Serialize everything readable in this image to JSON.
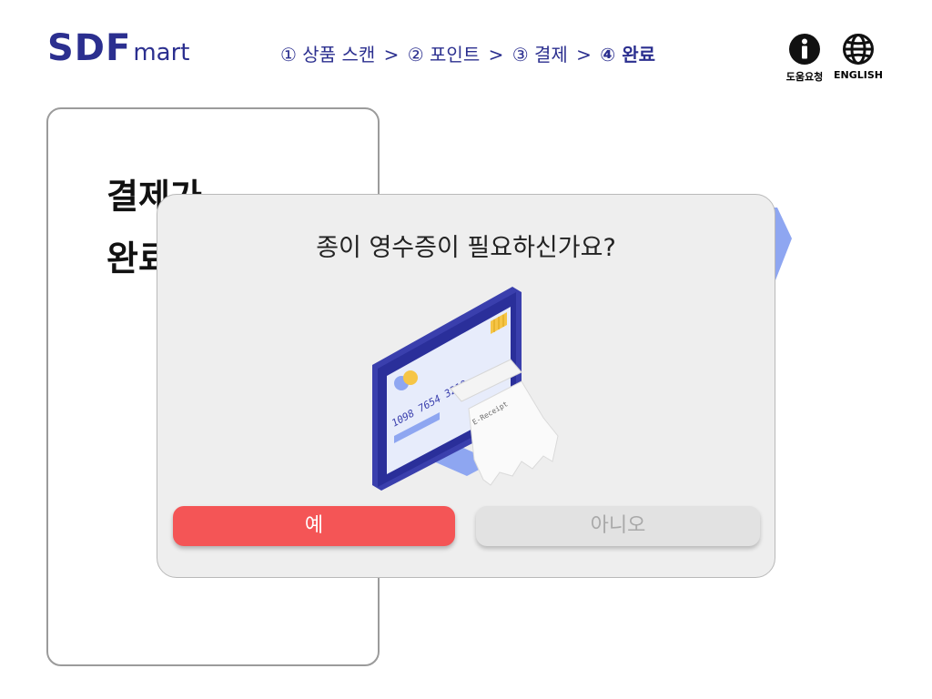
{
  "header": {
    "logo_main": "SDF",
    "logo_sub": "mart",
    "steps": [
      {
        "label": "① 상품 스캔"
      },
      {
        "label": "② 포인트"
      },
      {
        "label": "③ 결제"
      },
      {
        "label": "④ 완료",
        "active": true
      }
    ],
    "separator": ">",
    "help_label": "도움요청",
    "language_label": "ENGLISH"
  },
  "background_card": {
    "title": "결제가\n완료"
  },
  "dialog": {
    "question": "종이 영수증이 필요하신가요?",
    "yes_label": "예",
    "no_label": "아니오",
    "illustration": {
      "card_number": "1098 7654 3210",
      "receipt_text": "E-Receipt"
    }
  },
  "colors": {
    "brand": "#2b2f8f",
    "yes_button": "#f45556",
    "no_button": "#e2e2e2",
    "illustration_accent": "#8ea6f1"
  }
}
